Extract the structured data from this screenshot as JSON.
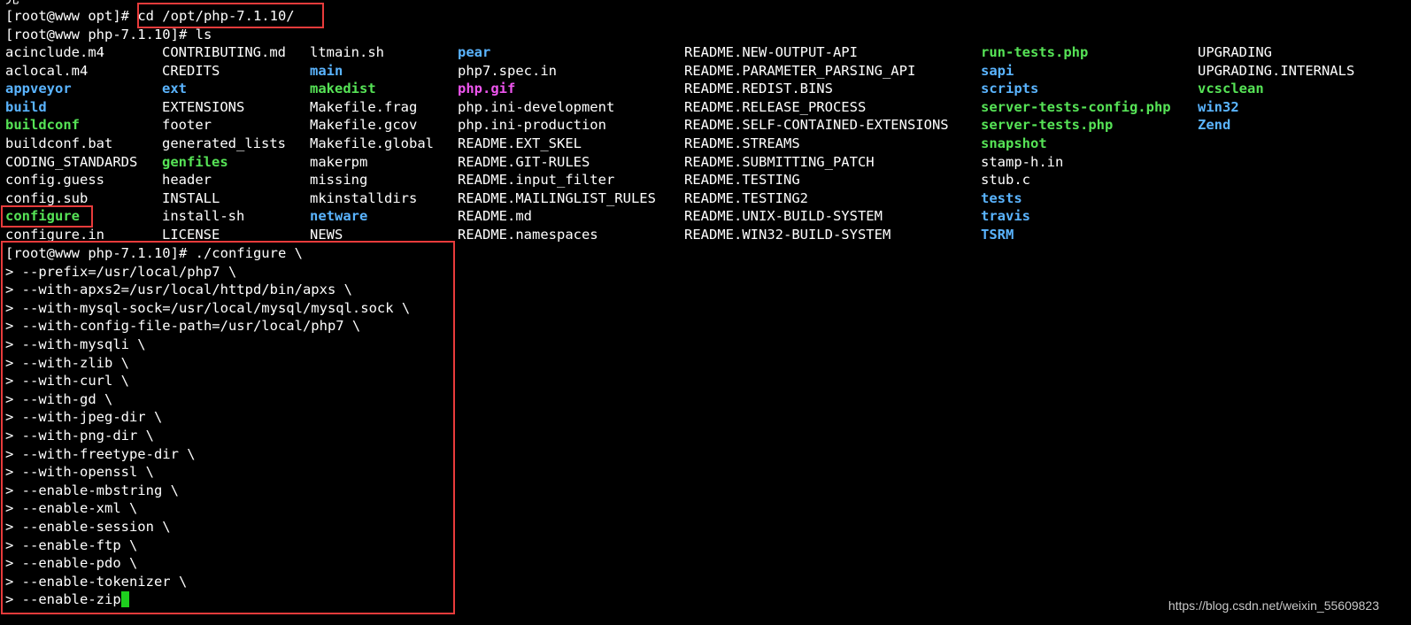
{
  "terminal": {
    "top_partial": "完 · ·",
    "prompt_cd": "[root@www opt]# ",
    "cmd_cd": "cd /opt/php-7.1.10/",
    "prompt_ls": "[root@www php-7.1.10]# ls",
    "listing": [
      [
        {
          "name": "acinclude.m4",
          "type": "file"
        },
        {
          "name": "CONTRIBUTING.md",
          "type": "file"
        },
        {
          "name": "ltmain.sh",
          "type": "file"
        },
        {
          "name": "pear",
          "type": "dir"
        },
        {
          "name": "README.NEW-OUTPUT-API",
          "type": "file"
        },
        {
          "name": "run-tests.php",
          "type": "exec"
        },
        {
          "name": "UPGRADING",
          "type": "file"
        }
      ],
      [
        {
          "name": "aclocal.m4",
          "type": "file"
        },
        {
          "name": "CREDITS",
          "type": "file"
        },
        {
          "name": "main",
          "type": "dir"
        },
        {
          "name": "php7.spec.in",
          "type": "file"
        },
        {
          "name": "README.PARAMETER_PARSING_API",
          "type": "file"
        },
        {
          "name": "sapi",
          "type": "dir"
        },
        {
          "name": "UPGRADING.INTERNALS",
          "type": "file"
        }
      ],
      [
        {
          "name": "appveyor",
          "type": "dir"
        },
        {
          "name": "ext",
          "type": "dir"
        },
        {
          "name": "makedist",
          "type": "exec"
        },
        {
          "name": "php.gif",
          "type": "img"
        },
        {
          "name": "README.REDIST.BINS",
          "type": "file"
        },
        {
          "name": "scripts",
          "type": "dir"
        },
        {
          "name": "vcsclean",
          "type": "exec"
        }
      ],
      [
        {
          "name": "build",
          "type": "dir"
        },
        {
          "name": "EXTENSIONS",
          "type": "file"
        },
        {
          "name": "Makefile.frag",
          "type": "file"
        },
        {
          "name": "php.ini-development",
          "type": "file"
        },
        {
          "name": "README.RELEASE_PROCESS",
          "type": "file"
        },
        {
          "name": "server-tests-config.php",
          "type": "exec"
        },
        {
          "name": "win32",
          "type": "dir"
        }
      ],
      [
        {
          "name": "buildconf",
          "type": "exec"
        },
        {
          "name": "footer",
          "type": "file"
        },
        {
          "name": "Makefile.gcov",
          "type": "file"
        },
        {
          "name": "php.ini-production",
          "type": "file"
        },
        {
          "name": "README.SELF-CONTAINED-EXTENSIONS",
          "type": "file"
        },
        {
          "name": "server-tests.php",
          "type": "exec"
        },
        {
          "name": "Zend",
          "type": "dir"
        }
      ],
      [
        {
          "name": "buildconf.bat",
          "type": "file"
        },
        {
          "name": "generated_lists",
          "type": "file"
        },
        {
          "name": "Makefile.global",
          "type": "file"
        },
        {
          "name": "README.EXT_SKEL",
          "type": "file"
        },
        {
          "name": "README.STREAMS",
          "type": "file"
        },
        {
          "name": "snapshot",
          "type": "exec"
        },
        {
          "name": "",
          "type": "file"
        }
      ],
      [
        {
          "name": "CODING_STANDARDS",
          "type": "file"
        },
        {
          "name": "genfiles",
          "type": "exec"
        },
        {
          "name": "makerpm",
          "type": "file"
        },
        {
          "name": "README.GIT-RULES",
          "type": "file"
        },
        {
          "name": "README.SUBMITTING_PATCH",
          "type": "file"
        },
        {
          "name": "stamp-h.in",
          "type": "file"
        },
        {
          "name": "",
          "type": "file"
        }
      ],
      [
        {
          "name": "config.guess",
          "type": "file"
        },
        {
          "name": "header",
          "type": "file"
        },
        {
          "name": "missing",
          "type": "file"
        },
        {
          "name": "README.input_filter",
          "type": "file"
        },
        {
          "name": "README.TESTING",
          "type": "file"
        },
        {
          "name": "stub.c",
          "type": "file"
        },
        {
          "name": "",
          "type": "file"
        }
      ],
      [
        {
          "name": "config.sub",
          "type": "file"
        },
        {
          "name": "INSTALL",
          "type": "file"
        },
        {
          "name": "mkinstalldirs",
          "type": "file"
        },
        {
          "name": "README.MAILINGLIST_RULES",
          "type": "file"
        },
        {
          "name": "README.TESTING2",
          "type": "file"
        },
        {
          "name": "tests",
          "type": "dir"
        },
        {
          "name": "",
          "type": "file"
        }
      ],
      [
        {
          "name": "configure",
          "type": "exec"
        },
        {
          "name": "install-sh",
          "type": "file"
        },
        {
          "name": "netware",
          "type": "dir"
        },
        {
          "name": "README.md",
          "type": "file"
        },
        {
          "name": "README.UNIX-BUILD-SYSTEM",
          "type": "file"
        },
        {
          "name": "travis",
          "type": "dir"
        },
        {
          "name": "",
          "type": "file"
        }
      ],
      [
        {
          "name": "configure.in",
          "type": "file"
        },
        {
          "name": "LICENSE",
          "type": "file"
        },
        {
          "name": "NEWS",
          "type": "file"
        },
        {
          "name": "README.namespaces",
          "type": "file"
        },
        {
          "name": "README.WIN32-BUILD-SYSTEM",
          "type": "file"
        },
        {
          "name": "TSRM",
          "type": "dir"
        },
        {
          "name": "",
          "type": "file"
        }
      ]
    ],
    "configure_lines": [
      "[root@www php-7.1.10]# ./configure \\",
      "> --prefix=/usr/local/php7 \\",
      "> --with-apxs2=/usr/local/httpd/bin/apxs \\",
      "> --with-mysql-sock=/usr/local/mysql/mysql.sock \\",
      "> --with-config-file-path=/usr/local/php7 \\",
      "> --with-mysqli \\",
      "> --with-zlib \\",
      "> --with-curl \\",
      "> --with-gd \\",
      "> --with-jpeg-dir \\",
      "> --with-png-dir \\",
      "> --with-freetype-dir \\",
      "> --with-openssl \\",
      "> --enable-mbstring \\",
      "> --enable-xml \\",
      "> --enable-session \\",
      "> --enable-ftp \\",
      "> --enable-pdo \\",
      "> --enable-tokenizer \\",
      "> --enable-zip"
    ],
    "colors": {
      "background": "#000000",
      "text": "#ffffff",
      "exec": "#56e356",
      "dir": "#5ab4ff",
      "img": "#ee55ee",
      "highlight": "#e83b3b",
      "cursor": "#1ecf1e"
    }
  },
  "watermark": "https://blog.csdn.net/weixin_55609823"
}
